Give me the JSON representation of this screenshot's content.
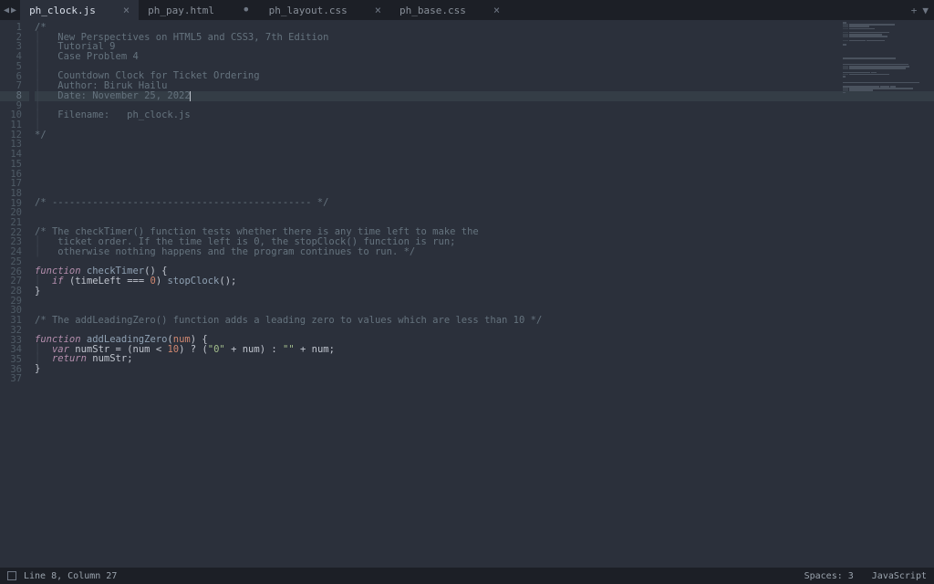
{
  "tabs": [
    {
      "label": "ph_clock.js",
      "state": "close",
      "active": true
    },
    {
      "label": "ph_pay.html",
      "state": "dot",
      "active": false
    },
    {
      "label": "ph_layout.css",
      "state": "close",
      "active": false
    },
    {
      "label": "ph_base.css",
      "state": "close",
      "active": false
    }
  ],
  "gutter_current": 8,
  "line_count": 37,
  "code_lines": {
    "l1": "/*",
    "l2": "   New Perspectives on HTML5 and CSS3, 7th Edition",
    "l3": "   Tutorial 9",
    "l4": "   Case Problem 4",
    "l5": "",
    "l6": "   Countdown Clock for Ticket Ordering",
    "l7": "   Author: Biruk Hailu",
    "l8": "   Date: November 25, 2022",
    "l9": "",
    "l10": "   Filename:   ph_clock.js",
    "l11": "",
    "l12": "*/",
    "l19": "/* --------------------------------------------- */",
    "l22": "/* The checkTimer() function tests whether there is any time left to make the",
    "l23": "   ticket order. If the time left is 0, the stopClock() function is run;",
    "l24": "   otherwise nothing happens and the program continues to run. */",
    "l31": "/* The addLeadingZero() function adds a leading zero to values which are less than 10 */"
  },
  "tokens": {
    "function": "function",
    "checkTimer": "checkTimer",
    "if": "if",
    "timeLeft": "timeLeft",
    "eq": "===",
    "zero": "0",
    "stopClock": "stopClock",
    "addLeadingZero": "addLeadingZero",
    "num": "num",
    "var": "var",
    "numStr": "numStr",
    "ten": "10",
    "zeroStr": "\"0\"",
    "emptyStr": "\"\"",
    "return": "return"
  },
  "status": {
    "position": "Line 8, Column 27",
    "spaces": "Spaces: 3",
    "lang": "JavaScript"
  },
  "icons": {
    "plus": "+",
    "dropdown": "▼",
    "left": "◀",
    "right": "▶",
    "close": "×",
    "dot": "•"
  }
}
